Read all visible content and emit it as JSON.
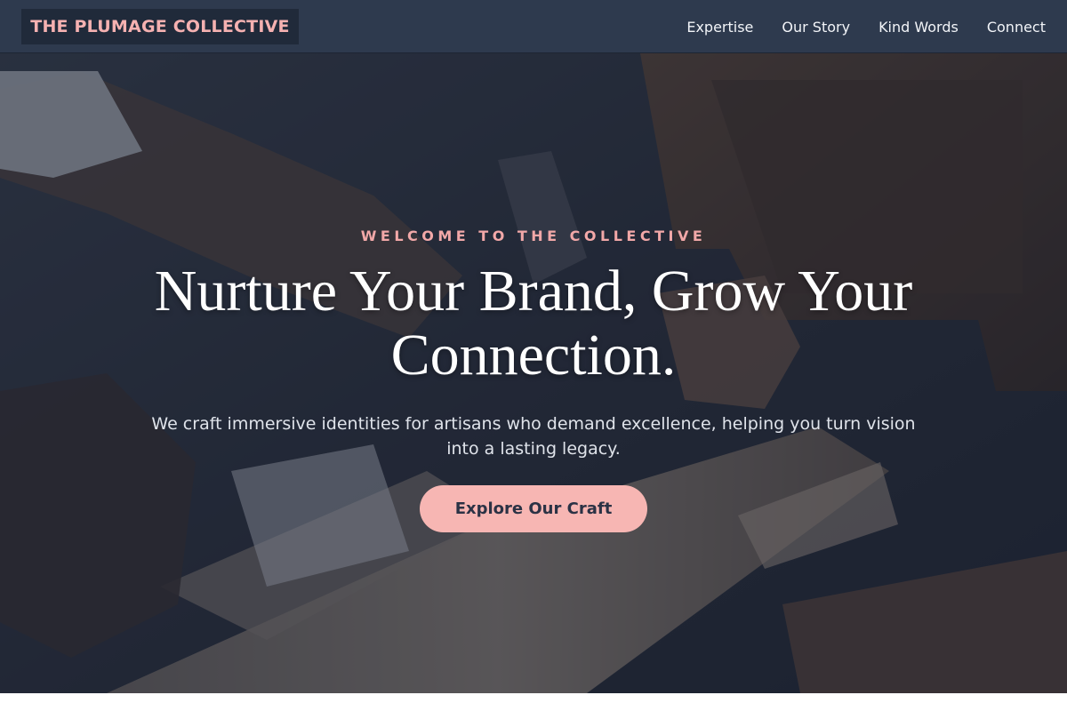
{
  "header": {
    "logo": "THE PLUMAGE COLLECTIVE",
    "nav": [
      {
        "label": "Expertise"
      },
      {
        "label": "Our Story"
      },
      {
        "label": "Kind Words"
      },
      {
        "label": "Connect"
      }
    ]
  },
  "hero": {
    "eyebrow": "WELCOME TO THE COLLECTIVE",
    "headline": "Nurture Your Brand, Grow Your Connection.",
    "subtext": "We craft immersive identities for artisans who demand excellence, helping you turn vision into a lasting legacy.",
    "cta_label": "Explore Our Craft",
    "background": "woodworking-photo"
  },
  "colors": {
    "header_bg": "#2e3a4e",
    "accent": "#f7b6b3",
    "logo_text": "#f5b1b1"
  }
}
